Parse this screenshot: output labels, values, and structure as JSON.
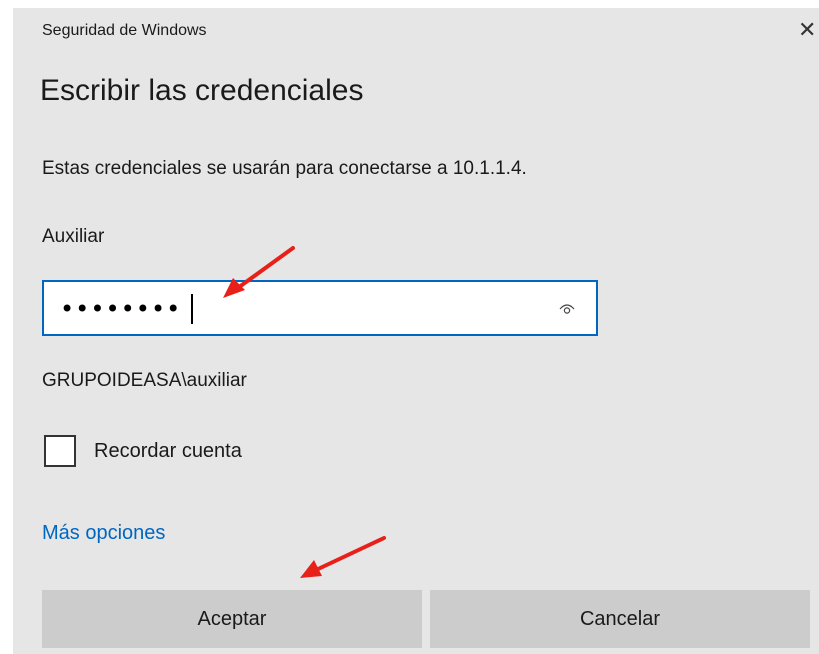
{
  "window": {
    "title": "Seguridad de Windows",
    "close_symbol": "✕"
  },
  "dialog": {
    "heading": "Escribir las credenciales",
    "description": "Estas credenciales se usarán para conectarse a 10.1.1.4.",
    "username": "Auxiliar",
    "password_masked": "••••••••",
    "domain_user": "GRUPOIDEASA\\auxiliar",
    "remember_label": "Recordar cuenta",
    "remember_checked": false,
    "more_options": "Más opciones"
  },
  "buttons": {
    "accept": "Aceptar",
    "cancel": "Cancelar"
  },
  "icons": {
    "reveal": "eye-icon",
    "annotation": "red-arrow-icon"
  },
  "colors": {
    "accent": "#0067c0",
    "annotation": "#e8201a",
    "panel_bg": "#e6e6e6",
    "button_bg": "#cccccc"
  }
}
